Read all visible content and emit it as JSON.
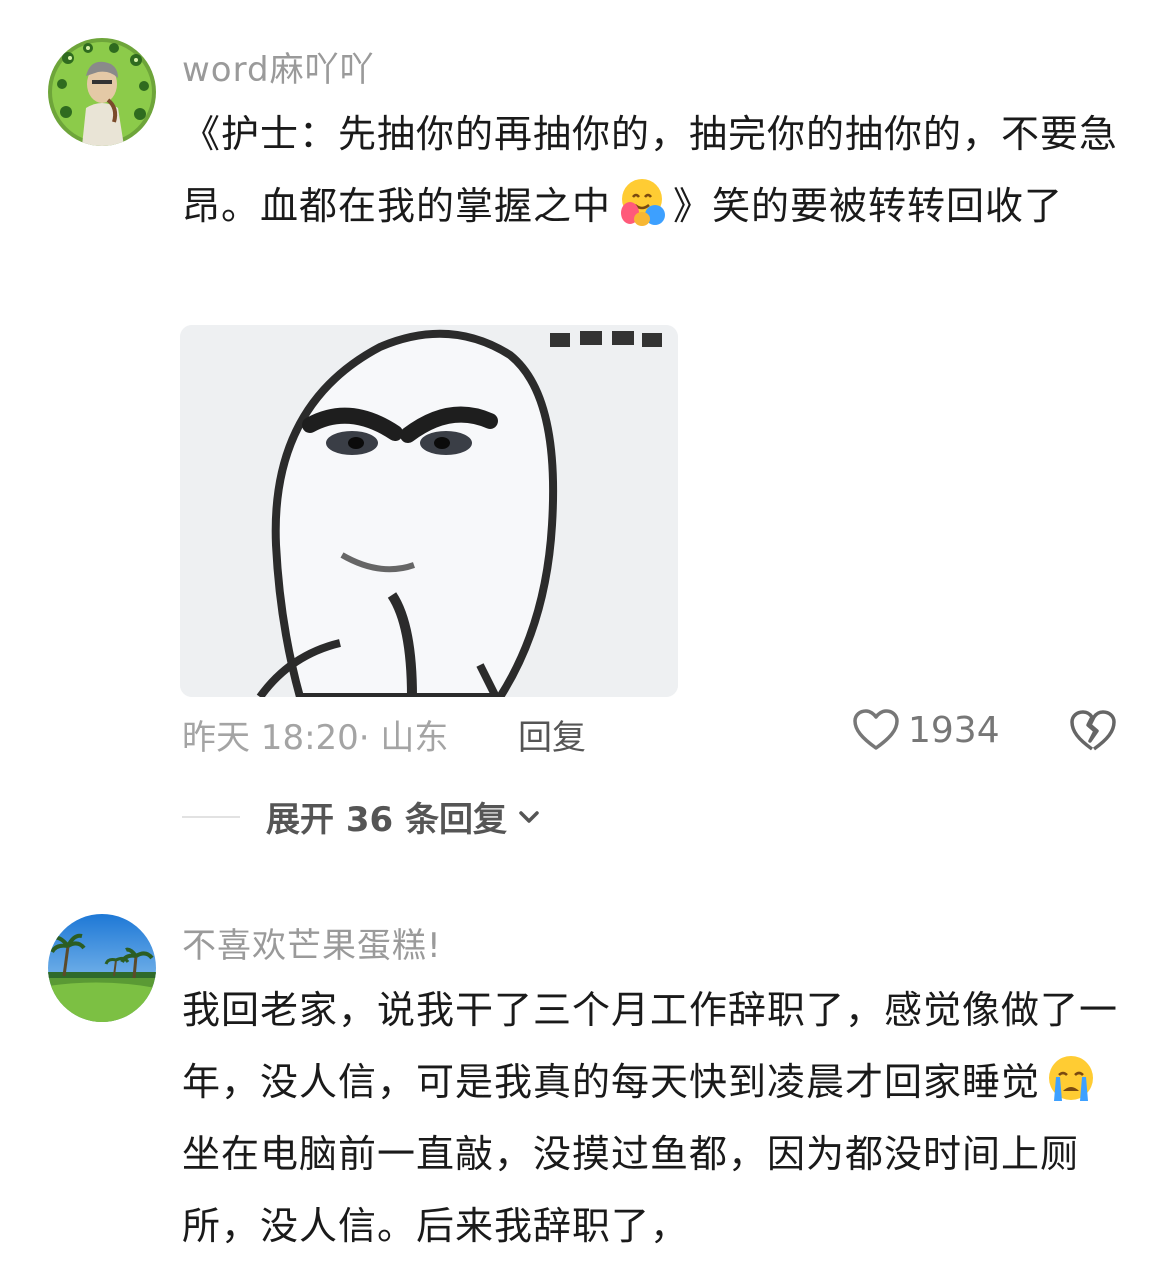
{
  "comments": [
    {
      "username": "word麻吖吖",
      "text_before_emoji": "《护士：先抽你的再抽你的，抽完你的抽你的，不要急昂。血都在我的掌握之中",
      "text_after_emoji": "》笑的要被转转回收了",
      "emoji_icon": "hugging-face-emoji",
      "has_image": true,
      "time": "昨天 18:20",
      "location": "山东",
      "reply_label": "回复",
      "likes": "1934",
      "expand_label": "展开 36 条回复"
    },
    {
      "username": "不喜欢芒果蛋糕!",
      "text_before_emoji": "我回老家，说我干了三个月工作辞职了，感觉像做了一年，没人信，可是我真的每天快到凌晨才回家睡觉",
      "text_after_emoji": "坐在电脑前一直敲，没摸过鱼都，因为都没时间上厕所，没人信。后来我辞职了，",
      "emoji_icon": "crying-face-emoji"
    }
  ],
  "colors": {
    "username": "#9a9a9a",
    "text": "#1a1a1a",
    "meta": "#a4a4a4"
  }
}
